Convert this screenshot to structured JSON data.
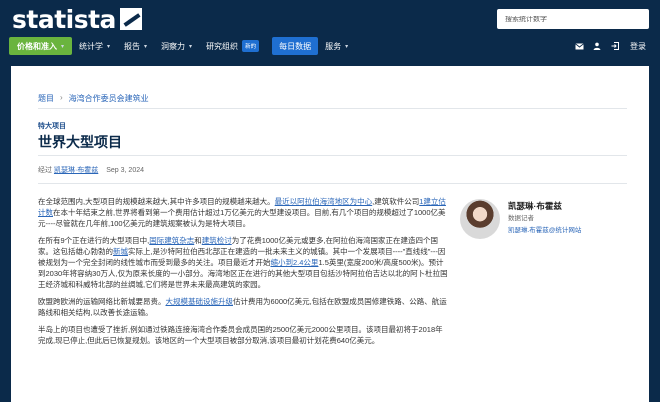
{
  "header": {
    "logo_text": "statista",
    "search_placeholder": "搜索统计数字"
  },
  "nav": {
    "items": [
      {
        "label": "价格和准入",
        "caret": "▾"
      },
      {
        "label": "统计学",
        "caret": "▾"
      },
      {
        "label": "报告",
        "caret": "▾"
      },
      {
        "label": "洞察力",
        "caret": "▾"
      },
      {
        "label": "研究组织",
        "badge": "新的"
      },
      {
        "label": "每日数据"
      },
      {
        "label": "服务",
        "caret": "▾"
      }
    ],
    "login": "登录"
  },
  "breadcrumb": {
    "items": [
      "题目",
      "海湾合作委员会建筑业"
    ]
  },
  "article": {
    "kicker": "特大项目",
    "title": "世界大型项目",
    "byline_prefix": "经过",
    "author": "凯瑟琳·布霍兹",
    "date": "Sep 3, 2024",
    "p1_a": "在全球范围内,大型项目的规模越来越大,其中许多项目的规模越来越大。",
    "p1_link1": "最近以阿拉伯海湾地区为中心",
    "p1_b": ",建筑软件公司",
    "p1_link2": "1建立估计数",
    "p1_c": "在本十年结束之前,世界将看到第一个费用估计超过1万亿美元的大型建设项目。目前,有几个项目的规模超过了1000亿美元----尽管就在几年前,100亿美元的建筑规案被认为是特大项目。",
    "p2_a": "在所有9个正在进行的大型项目中,",
    "p2_link1": "国际建筑杂志",
    "p2_b": "和",
    "p2_link2": "建筑检讨",
    "p2_c": "为了花费1000亿美元或更多,在阿拉伯海湾国家正在建造四个国家。这包括雄心勃勃的",
    "p2_link3": "新城",
    "p2_d": "实际上,是沙特阿拉伯西北部正在建造的一批未来主义的城镇。其中一个发展项目----\"直线线\"---因被规划为一个完全封闭的线性城市而受到最多的关注。项目最近才开始",
    "p2_link4": "缩小到2.4公里",
    "p2_e": "1.5英里(宽度200米/高度500米)。预计到2030年将容纳30万人,仅为原来长度的一小部分。海湾地区正在进行的其他大型项目包括沙特阿拉伯吉达以北的阿卜杜拉国王经济城和科威特北部的丝绸城,它们将是世界未来最高建筑的家园。",
    "p3_a": "欧盟跨欧洲的运输网络比新城要昂贵。",
    "p3_link1": "大规模基础设施升级",
    "p3_b": "估计费用为6000亿美元,包括在欧盟成员国修建铁路、公路、航运路线和相关结构,以改善长途运输。",
    "p4": "半岛上的项目也遭受了挫折,例如通过铁路连接海湾合作委员会成员国的2500亿美元2000公里项目。该项目最初将于2018年完成,现已停止,但此后已恢复规划。该地区的一个大型项目被部分取消,该项目最初计划花费640亿美元。"
  },
  "author_card": {
    "name": "凯瑟琳·布霍兹",
    "role": "数据记者",
    "email": "凯瑟琳.布霍兹@统计网站"
  },
  "colors": {
    "header_bg": "#0b2a4a",
    "accent_green": "#6ab43e",
    "accent_blue": "#1f6fd1",
    "link": "#2a66b8"
  }
}
